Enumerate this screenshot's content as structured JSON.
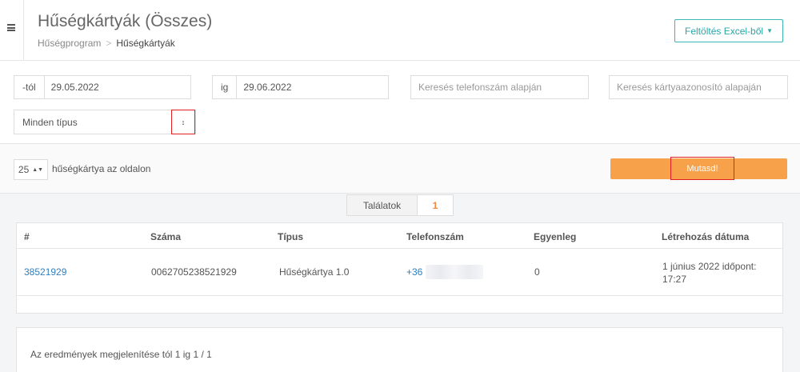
{
  "header": {
    "title": "Hűségkártyák (Összes)",
    "breadcrumb": [
      "Hűségprogram",
      "Hűségkártyák"
    ],
    "breadcrumb_sep": ">",
    "upload_button": "Feltöltés Excel-ből",
    "menu_icon": "hamburger-icon"
  },
  "filters": {
    "from_label": "-tól",
    "from_value": "29.05.2022",
    "to_label": "ig",
    "to_value": "29.06.2022",
    "phone_placeholder": "Keresés telefonszám alapján",
    "card_placeholder": "Keresés kártyaazonosító alapaján",
    "type_select": "Minden típus",
    "sort_icon": "↕"
  },
  "paging": {
    "per_page": "25",
    "per_page_label": "hűségkártya az oldalon",
    "show_button": "Mutasd!"
  },
  "results": {
    "label": "Találatok",
    "count": "1"
  },
  "table": {
    "columns": [
      "#",
      "Száma",
      "Típus",
      "Telefonszám",
      "Egyenleg",
      "Létrehozás dátuma"
    ],
    "rows": [
      {
        "id": "38521929",
        "number": "0062705238521929",
        "type": "Hűségkártya 1.0",
        "phone": "+36",
        "balance": "0",
        "created_line1": "1 június 2022 időpont:",
        "created_line2": "17:27"
      }
    ]
  },
  "footer": {
    "summary": "Az eredmények megjelenítése tól 1 ig 1 / 1"
  },
  "colors": {
    "accent_teal": "#3fb5b5",
    "orange_button": "#f7a14a",
    "link_blue": "#2f7fbf",
    "highlight_red": "#e02020"
  }
}
